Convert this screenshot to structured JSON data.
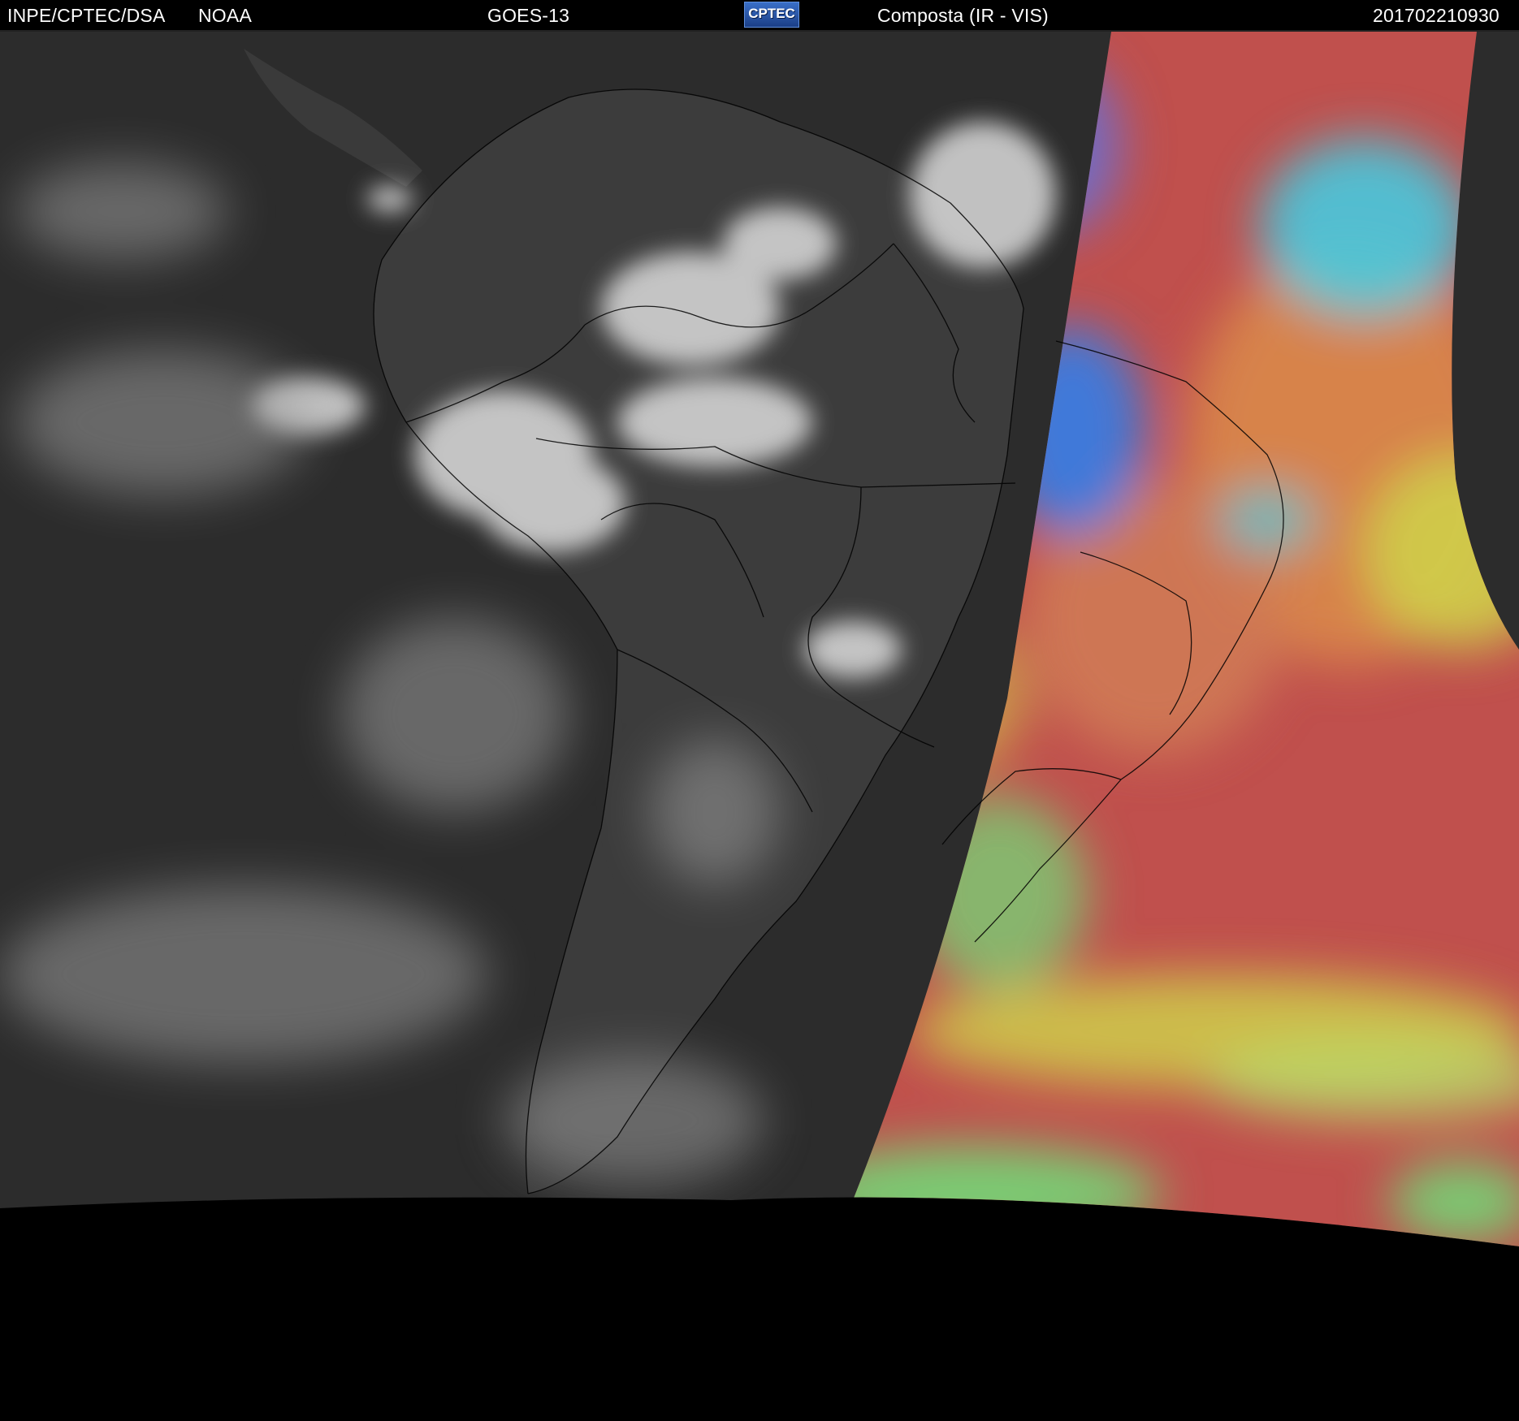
{
  "header": {
    "left_source": "INPE/CPTEC/DSA",
    "agency": "NOAA",
    "satellite": "GOES-13",
    "logo_text": "CPTEC",
    "product": "Composta (IR - VIS)",
    "timestamp": "201702210930"
  },
  "colors": {
    "ir_ocean": "#2c2c2c",
    "ir_land": "#3b3b3b",
    "cloud_bright": "#e6e6e6",
    "vis_red": "#c0504d",
    "vis_orange": "#d9884a",
    "vis_yellow": "#cfcf4a",
    "vis_green": "#6fe07a",
    "vis_blue": "#3a7be0",
    "vis_cyan": "#3fd0e8",
    "space": "#000000",
    "border_lines": "#000000"
  },
  "map": {
    "region": "South America",
    "left_panel": "infrared (grayscale)",
    "right_panel": "visible composite (false color)"
  }
}
